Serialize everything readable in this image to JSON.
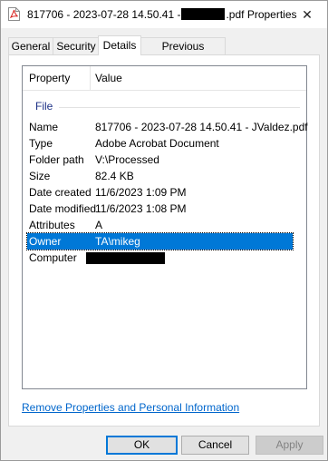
{
  "window": {
    "title_prefix": "817706 - 2023-07-28 14.50.41 -",
    "title_suffix": ".pdf Properties",
    "close_glyph": "✕"
  },
  "tabs": [
    {
      "label": "General"
    },
    {
      "label": "Security"
    },
    {
      "label": "Details"
    },
    {
      "label": "Previous Versions"
    }
  ],
  "listview": {
    "headers": {
      "property": "Property",
      "value": "Value"
    },
    "group": "File",
    "rows": [
      {
        "property": "Name",
        "value": "817706 - 2023-07-28 14.50.41 - JValdez.pdf"
      },
      {
        "property": "Type",
        "value": "Adobe Acrobat Document"
      },
      {
        "property": "Folder path",
        "value": "V:\\Processed"
      },
      {
        "property": "Size",
        "value": "82.4 KB"
      },
      {
        "property": "Date created",
        "value": "11/6/2023 1:09 PM"
      },
      {
        "property": "Date modified",
        "value": "11/6/2023 1:08 PM"
      },
      {
        "property": "Attributes",
        "value": "A"
      },
      {
        "property": "Owner",
        "value": "TA\\mikeg"
      },
      {
        "property": "Computer",
        "value": ""
      }
    ]
  },
  "link": {
    "remove_properties": "Remove Properties and Personal Information"
  },
  "buttons": {
    "ok": "OK",
    "cancel": "Cancel",
    "apply": "Apply"
  },
  "colors": {
    "selection": "#0078d7",
    "link": "#0066cc",
    "group": "#1e3287",
    "pdf_icon": "#d9201e"
  }
}
